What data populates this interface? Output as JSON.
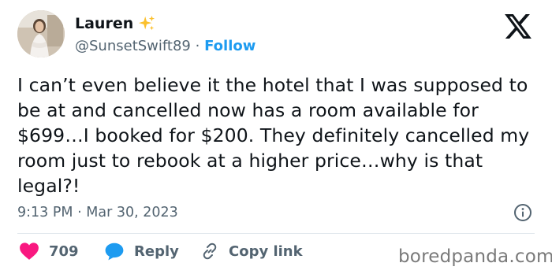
{
  "author": {
    "name": "Lauren",
    "handle": "@SunsetSwift89",
    "separator": "·",
    "follow_label": "Follow"
  },
  "tweet": {
    "text": "I can’t even believe it the hotel that I was supposed to be at and cancelled now has a room available for $699…I booked for $200. They definitely cancelled my room just to rebook at a higher price…why is that legal?!",
    "time": "9:13 PM",
    "separator": "·",
    "date": "Mar 30, 2023"
  },
  "actions": {
    "like_count": "709",
    "reply_label": "Reply",
    "copy_link_label": "Copy link"
  },
  "watermark": "boredpanda.com",
  "icons": {
    "sparkle": "sparkles-icon",
    "x_logo": "x-logo-icon",
    "info": "info-icon",
    "like": "heart-icon",
    "reply": "reply-bubble-icon",
    "link": "link-icon"
  },
  "colors": {
    "accent": "#1d9bf0",
    "like": "#f91880",
    "sparkle": "#fbc02d",
    "secondary_text": "#536471"
  }
}
